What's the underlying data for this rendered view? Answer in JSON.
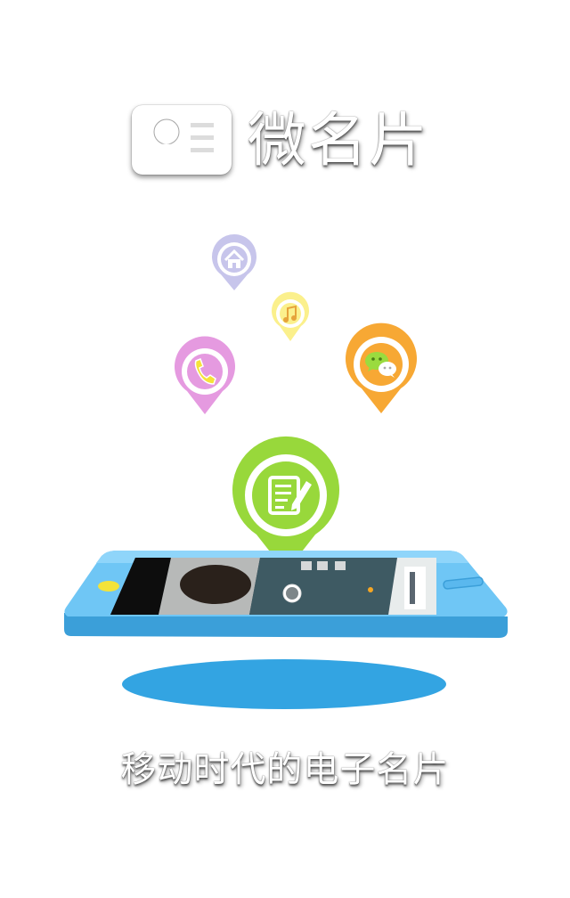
{
  "app": {
    "title": "微名片",
    "tagline": "移动时代的电子名片"
  },
  "icons": {
    "logo": "contact-card-icon",
    "home": "home-icon",
    "music": "music-note-icon",
    "phone": "phone-icon",
    "wechat": "wechat-icon",
    "edit": "edit-note-icon"
  },
  "colors": {
    "home_pin": "#c7c5eb",
    "music_pin": "#fbf08c",
    "phone_pin": "#e59ae0",
    "wechat_pin": "#f7a834",
    "edit_pin": "#98d83b",
    "phone_body": "#5ab8ee",
    "shadow": "#33a4e2"
  }
}
